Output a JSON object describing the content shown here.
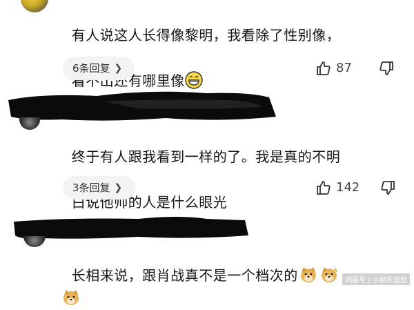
{
  "comments": [
    {
      "text_line1": "有人说这人长得像黎明，我看除了性别像，",
      "text_line2": "看不出还有哪里像",
      "emoji": "grinning-face",
      "replies_label": "6条回复",
      "likes": "87"
    },
    {
      "text_line1": "终于有人跟我看到一样的了。我是真的不明",
      "text_line2": "白说他帅的人是什么眼光",
      "replies_label": "3条回复",
      "likes": "142"
    },
    {
      "text_line1": "长相来说，跟肖战真不是一个档次的",
      "emoji": "doge"
    }
  ],
  "watermark": "网易号 | 小娱乐悠悠",
  "colors": {
    "text": "#161616",
    "pill_bg": "#f3f3f3",
    "icon": "#333333",
    "redaction": "#0b0b0b"
  }
}
